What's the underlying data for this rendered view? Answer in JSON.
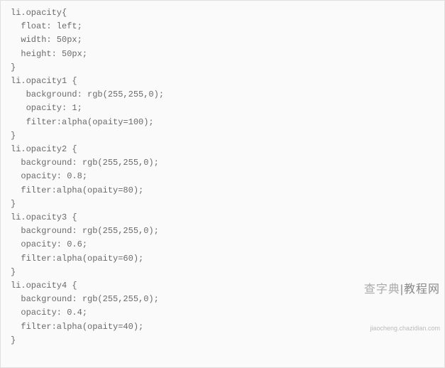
{
  "code": {
    "lines": [
      "li.opacity{",
      "  float: left;",
      "  width: 50px;",
      "  height: 50px;",
      "}",
      "li.opacity1 {",
      "   background: rgb(255,255,0);",
      "   opacity: 1;",
      "   filter:alpha(opaity=100);",
      "}",
      "li.opacity2 {",
      "  background: rgb(255,255,0);",
      "  opacity: 0.8;",
      "  filter:alpha(opaity=80);",
      "}",
      "li.opacity3 {",
      "  background: rgb(255,255,0);",
      "  opacity: 0.6;",
      "  filter:alpha(opaity=60);",
      "}",
      "li.opacity4 {",
      "  background: rgb(255,255,0);",
      "  opacity: 0.4;",
      "  filter:alpha(opaity=40);",
      "}"
    ]
  },
  "watermark": {
    "main_left": "查字典",
    "main_right": "教程网",
    "sub": "jiaocheng.chazidian.com"
  }
}
